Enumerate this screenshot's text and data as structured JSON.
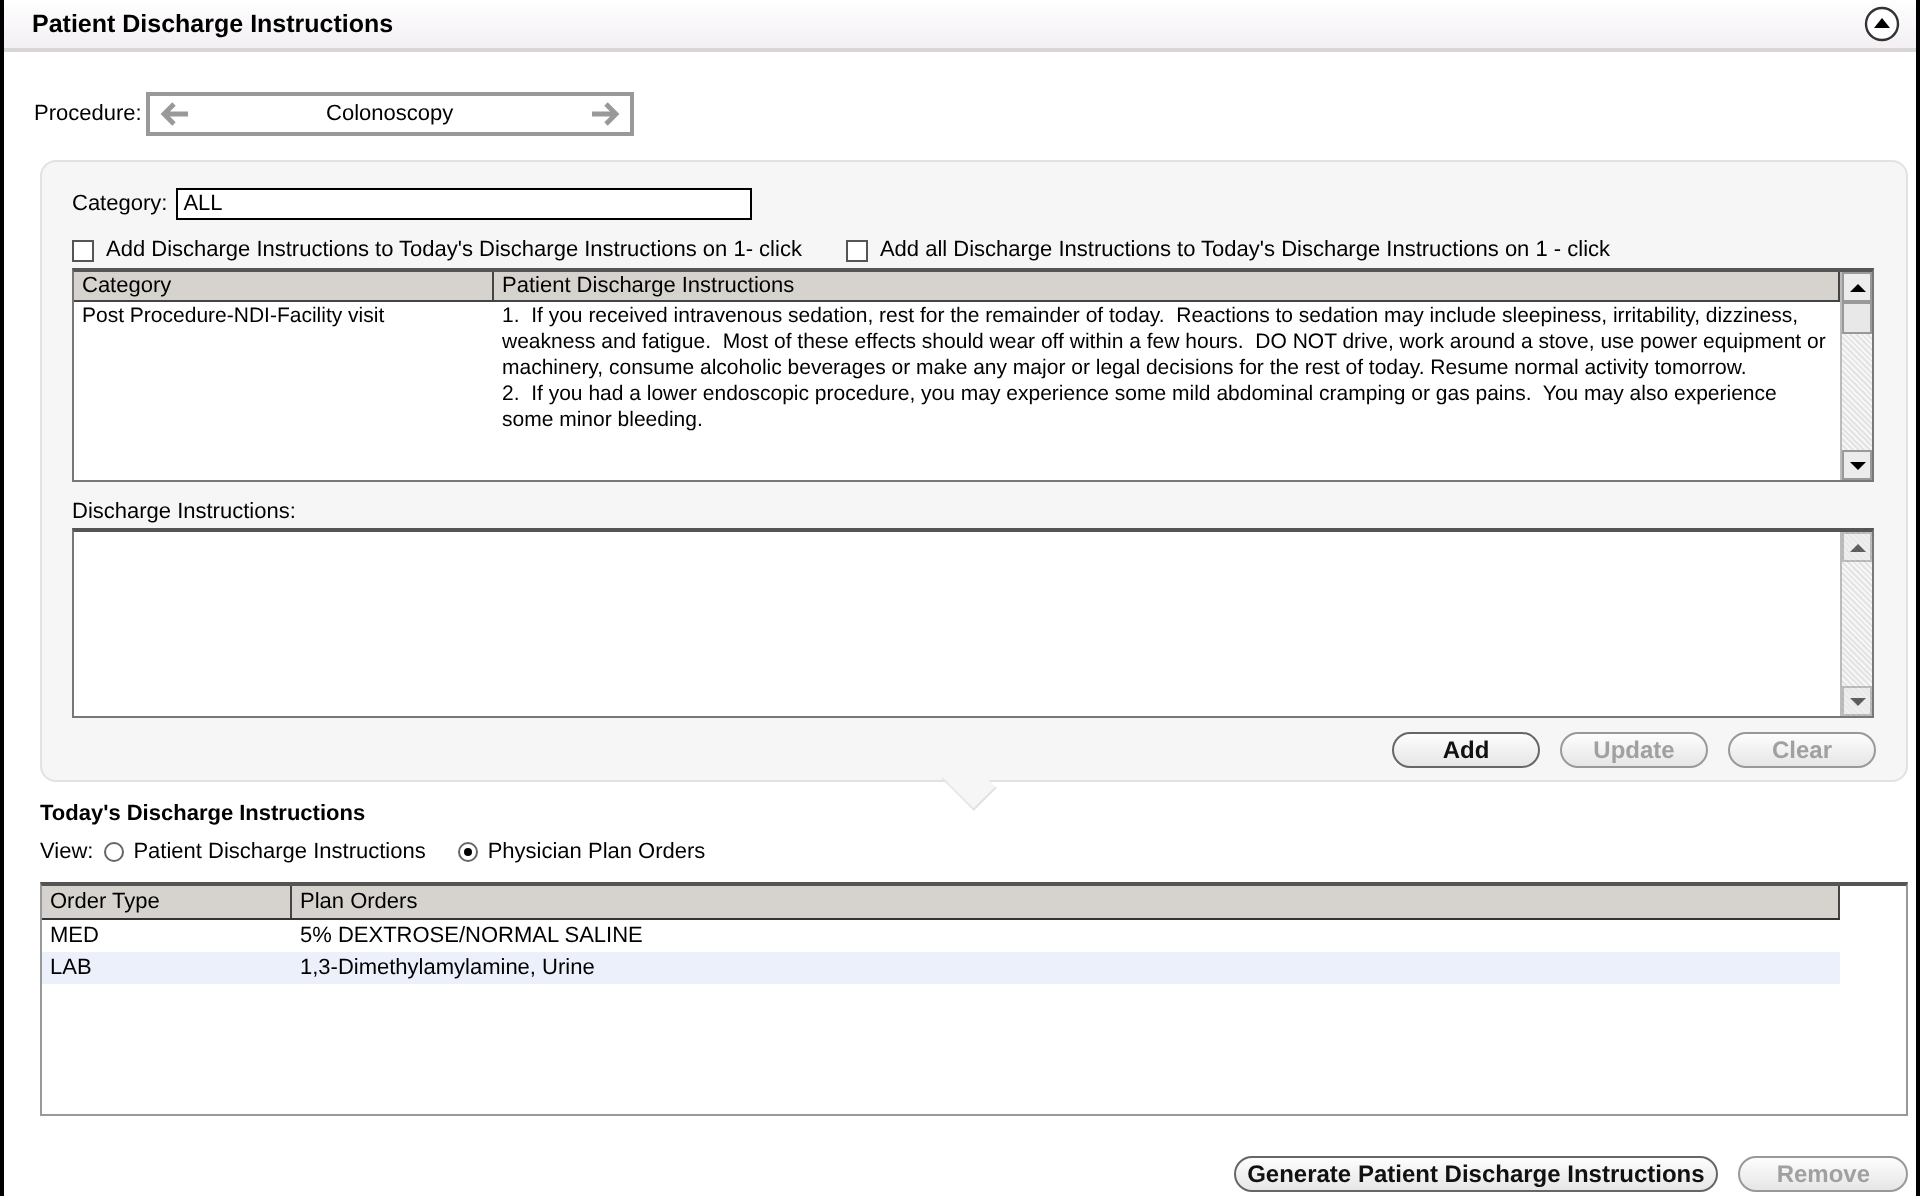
{
  "header": {
    "title": "Patient Discharge Instructions"
  },
  "procedure": {
    "label": "Procedure:",
    "value": "Colonoscopy"
  },
  "category": {
    "label": "Category:",
    "value": "ALL"
  },
  "options": [
    {
      "label": "Add Discharge Instructions to Today's Discharge Instructions on 1- click",
      "checked": false
    },
    {
      "label": "Add all Discharge Instructions to Today's Discharge Instructions on 1 - click",
      "checked": false
    }
  ],
  "instructions_table": {
    "columns": [
      "Category",
      "Patient Discharge Instructions"
    ],
    "rows": [
      {
        "category": "Post Procedure-NDI-Facility visit",
        "instructions": [
          "1.  If you received intravenous sedation, rest for the remainder of today.  Reactions to sedation may include sleepiness, irritability, dizziness, weakness and fatigue.  Most of these effects should wear off within a few hours.  DO NOT drive, work around a stove, use power equipment or machinery, consume alcoholic beverages or make any major or legal decisions for the rest of today. Resume normal activity tomorrow.",
          "2.  If you had a lower endoscopic procedure, you may experience some mild abdominal cramping or gas pains.  You may also experience some minor bleeding."
        ]
      }
    ]
  },
  "discharge_instructions": {
    "label": "Discharge Instructions:"
  },
  "panel_buttons": [
    {
      "label": "Add",
      "disabled": false
    },
    {
      "label": "Update",
      "disabled": true
    },
    {
      "label": "Clear",
      "disabled": true
    }
  ],
  "today": {
    "title": "Today's Discharge Instructions",
    "view_label": "View:",
    "views": [
      {
        "label": "Patient Discharge Instructions",
        "selected": false
      },
      {
        "label": "Physician Plan Orders",
        "selected": true
      }
    ],
    "orders_table": {
      "columns": [
        "Order Type",
        "Plan Orders"
      ],
      "rows": [
        {
          "cells": [
            "MED",
            "5% DEXTROSE/NORMAL SALINE"
          ],
          "selected": false
        },
        {
          "cells": [
            "LAB",
            "1,3-Dimethylamylamine, Urine"
          ],
          "selected": true
        }
      ]
    }
  },
  "footer_buttons": [
    {
      "label": "Generate Patient Discharge Instructions",
      "disabled": false
    },
    {
      "label": "Remove",
      "disabled": true
    }
  ]
}
